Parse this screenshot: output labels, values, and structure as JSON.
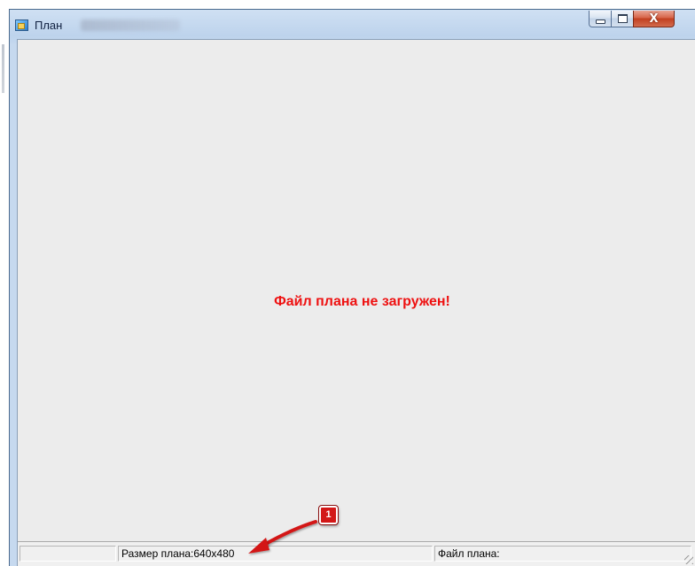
{
  "window": {
    "title": "План",
    "min_icon": "minimize-icon",
    "max_icon": "maximize-icon",
    "close_icon": "close-icon",
    "close_glyph": "X"
  },
  "content": {
    "message": "Файл плана не загружен!",
    "message_color": "#ee1111"
  },
  "status_bar": {
    "panel1": "",
    "plan_size": "Размер плана:640x480",
    "plan_file": "Файл плана:"
  },
  "annotation": {
    "badge_label": "1",
    "badge_color": "#d31818"
  }
}
